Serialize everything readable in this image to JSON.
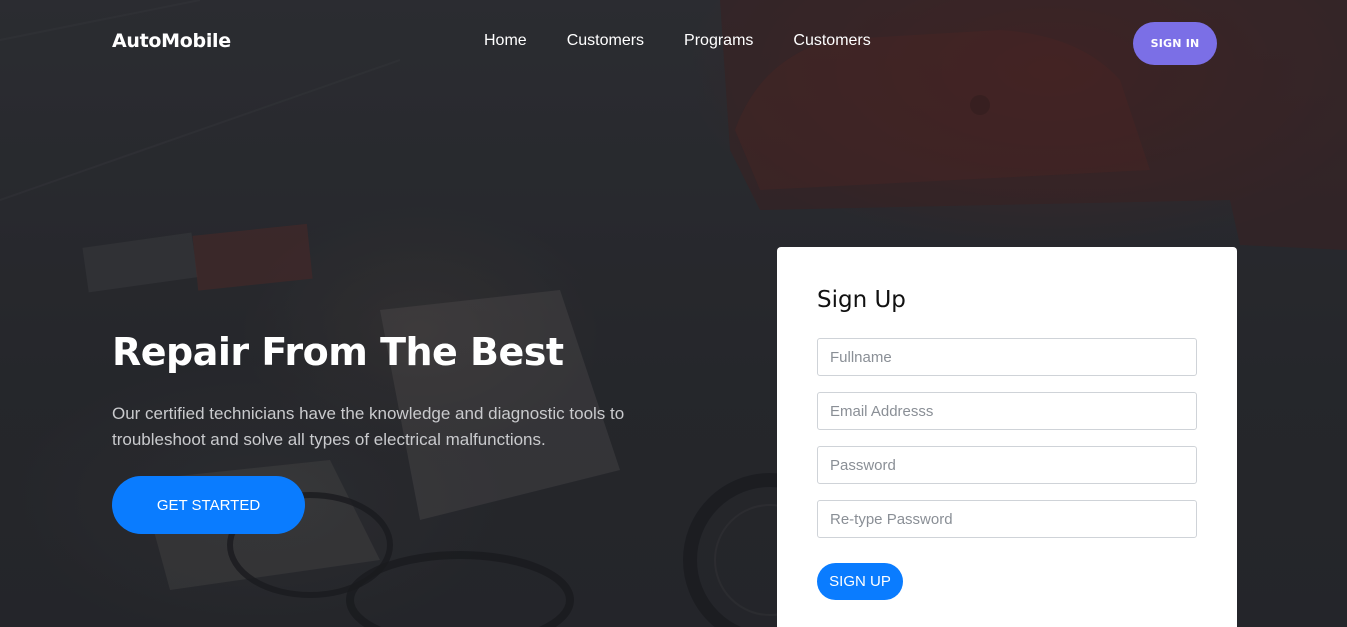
{
  "nav": {
    "brand": "AutoMobile",
    "links": [
      {
        "label": "Home"
      },
      {
        "label": "Customers"
      },
      {
        "label": "Programs"
      },
      {
        "label": "Customers"
      }
    ],
    "signin_label": "SIGN IN"
  },
  "hero": {
    "title": "Repair From The Best",
    "text": "Our certified technicians have the knowledge and diagnostic tools to troubleshoot and solve all types of electrical malfunctions.",
    "cta_label": "GET STARTED"
  },
  "signup": {
    "title": "Sign Up",
    "fields": [
      {
        "placeholder": "Fullname",
        "value": ""
      },
      {
        "placeholder": "Email Addresss",
        "value": ""
      },
      {
        "placeholder": "Password",
        "value": ""
      },
      {
        "placeholder": "Re-type Password",
        "value": ""
      }
    ],
    "submit_label": "SIGN UP"
  },
  "colors": {
    "accent_blue": "#0a7cff",
    "accent_purple": "#7b6fe6",
    "overlay_dark": "#2f3135"
  }
}
